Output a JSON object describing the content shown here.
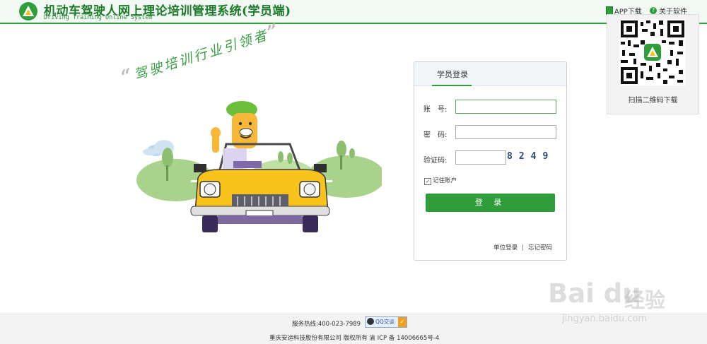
{
  "header": {
    "title_cn": "机动车驾驶人网上理论培训管理系统(学员端)",
    "title_en": "Driving Training Online System",
    "app_download": "APP下载",
    "about": "关于软件"
  },
  "qr": {
    "caption": "扫描二维码下载"
  },
  "slogan": {
    "text": "驾驶培训行业引领者",
    "open_quote": "“",
    "close_quote": "”"
  },
  "login": {
    "tab": "学员登录",
    "account_label": "账　号:",
    "password_label": "密　码:",
    "captcha_label": "验证码:",
    "captcha_image_text": "8249",
    "remember": "记住账户",
    "submit": "登 录",
    "unit_login": "单位登录",
    "separator": "|",
    "forgot": "忘记密码",
    "account_value": "",
    "password_value": "",
    "captcha_value": ""
  },
  "footer": {
    "hotline": "服务热线:400-023-7989",
    "qq": "QQ交谈",
    "copyright": "重庆安运科技股份有限公司 版权所有 渝 ICP 备 14006665号-4"
  },
  "watermark": {
    "brand": "Bai du",
    "cn": "经验",
    "url": "jingyan.baidu.com"
  },
  "colors": {
    "brand_green": "#2e9d3a",
    "header_bg": "#f2f9f4"
  }
}
